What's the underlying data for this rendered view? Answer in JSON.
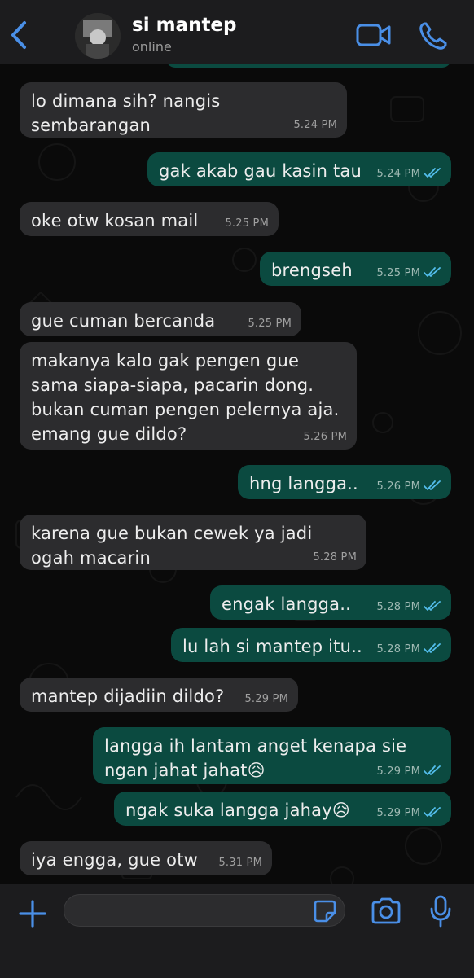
{
  "header": {
    "contact_name": "si mantep",
    "status": "online",
    "icons": {
      "back": "chevron-left-icon",
      "video": "video-camera-icon",
      "call": "phone-icon"
    }
  },
  "messages": [
    {
      "dir": "in",
      "text": "lo dimana sih? nangis sembarangan",
      "time": "5.24 PM"
    },
    {
      "dir": "out",
      "text": "gak akab gau kasin tau",
      "time": "5.24 PM",
      "read": true
    },
    {
      "dir": "in",
      "text": "oke otw kosan mail",
      "time": "5.25 PM"
    },
    {
      "dir": "out",
      "text": "brengseh",
      "time": "5.25 PM",
      "read": true
    },
    {
      "dir": "in",
      "text": "gue cuman bercanda",
      "time": "5.25 PM"
    },
    {
      "dir": "in",
      "text": "makanya kalo gak pengen gue sama siapa-siapa, pacarin dong. bukan cuman pengen pelernya aja. emang gue dildo?",
      "time": "5.26 PM"
    },
    {
      "dir": "out",
      "text": "hng langga..",
      "time": "5.26 PM",
      "read": true
    },
    {
      "dir": "in",
      "text": "karena gue bukan cewek ya jadi ogah macarin",
      "time": "5.28 PM"
    },
    {
      "dir": "out",
      "text": "engak langga..",
      "time": "5.28 PM",
      "read": true
    },
    {
      "dir": "out",
      "text": "lu lah si mantep itu..",
      "time": "5.28 PM",
      "read": true
    },
    {
      "dir": "in",
      "text": "mantep dijadiin dildo?",
      "time": "5.29 PM"
    },
    {
      "dir": "out",
      "text": "langga ih lantam anget kenapa sie ngan jahat jahat😥",
      "time": "5.29 PM",
      "read": true
    },
    {
      "dir": "out",
      "text": "ngak suka langga jahay😥",
      "time": "5.29 PM",
      "read": true
    },
    {
      "dir": "in",
      "text": "iya engga, gue otw",
      "time": "5.31 PM"
    }
  ],
  "composer": {
    "input_value": "",
    "icons": {
      "attach": "plus-icon",
      "sticker": "sticker-icon",
      "camera": "camera-icon",
      "mic": "microphone-icon"
    }
  },
  "colors": {
    "accent": "#4a8fe7",
    "incoming_bubble": "#2c2c2e",
    "outgoing_bubble": "#0b4a40",
    "read_check": "#53bdeb"
  }
}
